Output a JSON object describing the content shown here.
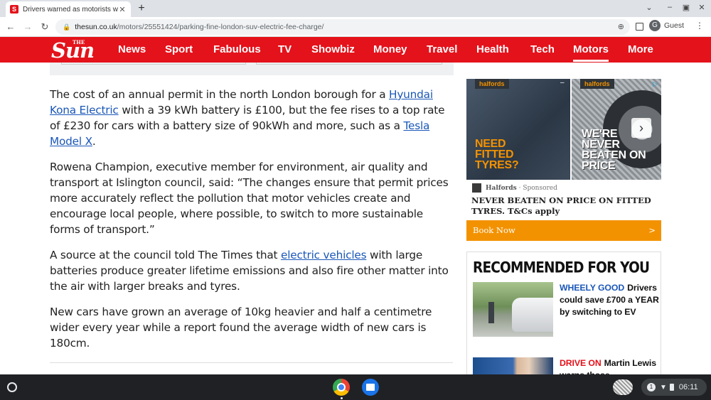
{
  "browser": {
    "tab_title": "Drivers warned as motorists with",
    "tab_favicon": "S",
    "url_host": "thesun.co.uk",
    "url_path": "/motors/25551424/parking-fine-london-suv-electric-fee-charge/",
    "profile_label": "Guest",
    "profile_initial": "G"
  },
  "site": {
    "logo_text": "Sun",
    "logo_prefix": "THE",
    "brand_color": "#e4121b",
    "nav": [
      "News",
      "Sport",
      "Fabulous",
      "TV",
      "Showbiz",
      "Money",
      "Travel",
      "Health",
      "Tech",
      "Motors",
      "More"
    ],
    "active_nav": "Motors"
  },
  "article": {
    "p1": {
      "t1": "The cost of an annual permit in the north London borough for a ",
      "link1": "Hyundai Kona Electric",
      "t2": " with a 39 kWh battery is £100, but the fee rises to a top rate of £230 for cars with a battery size of 90kWh and more, such as a ",
      "link2": "Tesla Model X",
      "t3": "."
    },
    "p2": "Rowena Champion, executive member for environment, air quality and transport at Islington council, said: “The changes ensure that permit prices more accurately reflect the pollution that motor vehicles create and encourage local people, where possible, to switch to more sustainable forms of transport.”",
    "p3": {
      "t1": "A source at the council told The Times that ",
      "link": "electric vehicles",
      "t2": " with large batteries produce greater lifetime emissions and also fire other matter into the air with larger breaks and tyres."
    },
    "p4": "New cars have grown an average of 10kg heavier and half a centimetre wider every year while a report found the average width of new cars is 180cm."
  },
  "ad": {
    "brand_tag": "halfords",
    "image1_text": "NEED FITTED TYRES?",
    "image2_text": "WE'RE NEVER BEATEN ON PRICE",
    "advertiser": "Halfords",
    "sponsored": "· Sponsored",
    "headline": "NEVER BEATEN ON PRICE ON FITTED TYRES. T&Cs apply",
    "cta": "Book Now",
    "cta_arrow": ">",
    "accent": "#f39200"
  },
  "recommended": {
    "title": "RECOMMENDED FOR YOU",
    "items": [
      {
        "kicker": "WHEELY GOOD",
        "text": "Drivers could save £700 a YEAR by switching to EV"
      },
      {
        "kicker": "DRIVE ON",
        "text": "Martin Lewis warns those"
      }
    ]
  },
  "shelf": {
    "notification_count": "1",
    "time": "06:11"
  }
}
